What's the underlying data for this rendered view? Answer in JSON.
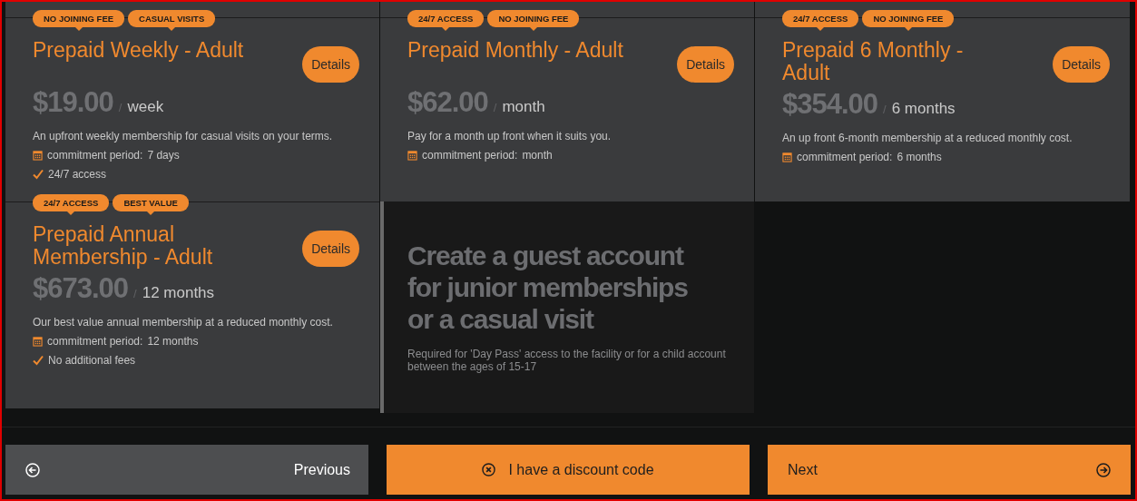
{
  "plans": [
    {
      "badges": [
        "NO JOINING FEE",
        "CASUAL VISITS"
      ],
      "title": "Prepaid Weekly - Adult",
      "button": "Details",
      "price": "$19.00",
      "separator": "/",
      "period": "week",
      "description": "An upfront weekly membership for casual visits on your terms.",
      "features": [
        {
          "kind": "calendar",
          "label": "commitment period:",
          "value": "7 days"
        },
        {
          "kind": "check",
          "label": "24/7 access"
        }
      ]
    },
    {
      "badges": [
        "24/7 ACCESS",
        "NO JOINING FEE"
      ],
      "title": "Prepaid Monthly - Adult",
      "button": "Details",
      "price": "$62.00",
      "separator": "/",
      "period": "month",
      "description": "Pay for a month up front when it suits you.",
      "features": [
        {
          "kind": "calendar",
          "label": "commitment period:",
          "value": "month"
        }
      ]
    },
    {
      "badges": [
        "24/7 ACCESS",
        "NO JOINING FEE"
      ],
      "title": "Prepaid 6 Monthly - Adult",
      "button": "Details",
      "price": "$354.00",
      "separator": "/",
      "period": "6 months",
      "description": "An up front 6-month membership at a reduced monthly cost.",
      "features": [
        {
          "kind": "calendar",
          "label": "commitment period:",
          "value": "6 months"
        }
      ]
    },
    {
      "badges": [
        "24/7 ACCESS",
        "BEST VALUE"
      ],
      "title": "Prepaid Annual Membership - Adult",
      "button": "Details",
      "price": "$673.00",
      "separator": "/",
      "period": "12 months",
      "description": "Our best value annual membership at a reduced monthly cost.",
      "features": [
        {
          "kind": "calendar",
          "label": "commitment period:",
          "value": "12 months"
        },
        {
          "kind": "check",
          "label": "No additional fees"
        }
      ]
    }
  ],
  "guest_panel": {
    "title": "Create a guest account for junior memberships or a casual visit",
    "text": "Required for 'Day Pass' access to the facility or for a child account between the ages of 15-17"
  },
  "footer": {
    "previous": "Previous",
    "discount": "I have a discount code",
    "next": "Next"
  }
}
